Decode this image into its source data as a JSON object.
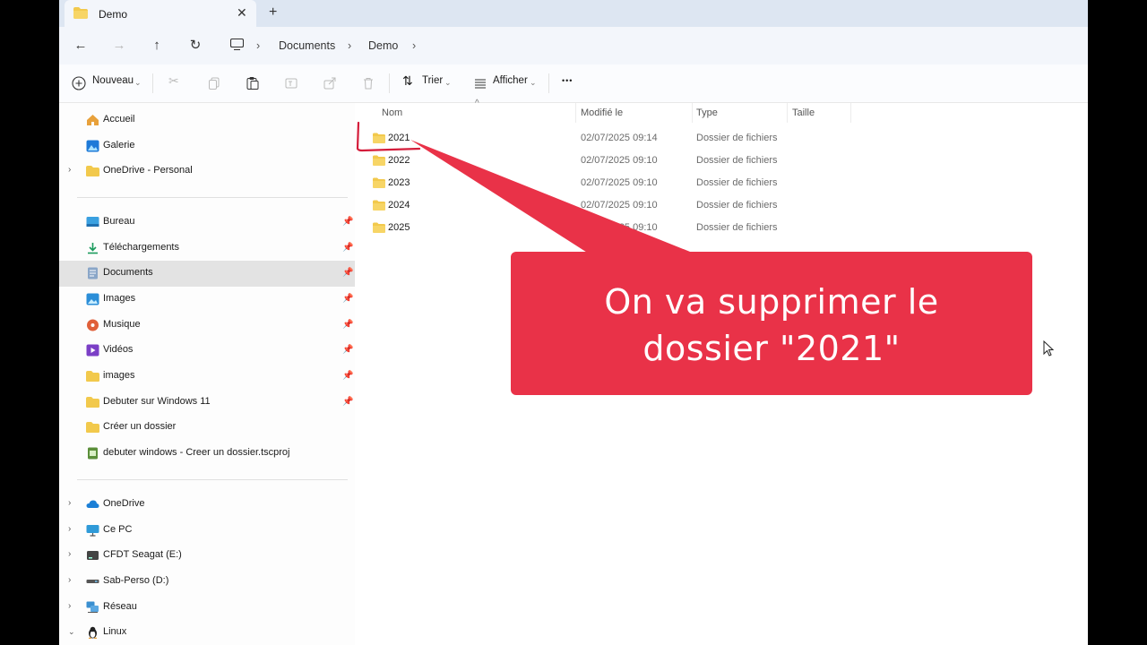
{
  "tab": {
    "title": "Demo",
    "close": "✕",
    "new": "+"
  },
  "address": {
    "crumbs": [
      "Documents",
      "Demo"
    ]
  },
  "commands": {
    "new_label": "Nouveau",
    "sort_label": "Trier",
    "view_label": "Afficher",
    "more_label": "•••"
  },
  "sidebar": {
    "quick": [
      {
        "label": "Accueil",
        "icon": "home-icon"
      },
      {
        "label": "Galerie",
        "icon": "gallery-icon"
      },
      {
        "label": "OneDrive - Personal",
        "icon": "folder-icon"
      }
    ],
    "pinned": [
      {
        "label": "Bureau",
        "icon": "desktop-icon"
      },
      {
        "label": "Téléchargements",
        "icon": "download-icon"
      },
      {
        "label": "Documents",
        "icon": "documents-icon",
        "selected": true
      },
      {
        "label": "Images",
        "icon": "images-icon"
      },
      {
        "label": "Musique",
        "icon": "music-icon"
      },
      {
        "label": "Vidéos",
        "icon": "video-icon"
      },
      {
        "label": "images",
        "icon": "folder-icon"
      },
      {
        "label": "Debuter sur Windows 11",
        "icon": "folder-icon"
      },
      {
        "label": "Créer un dossier",
        "icon": "folder-icon"
      },
      {
        "label": "debuter windows - Creer un dossier.tscproj",
        "icon": "project-file-icon"
      }
    ],
    "drives": [
      {
        "label": "OneDrive",
        "icon": "cloud-icon"
      },
      {
        "label": "Ce PC",
        "icon": "pc-icon"
      },
      {
        "label": "CFDT Seagat (E:)",
        "icon": "drive-icon"
      },
      {
        "label": "Sab-Perso (D:)",
        "icon": "drive-icon"
      },
      {
        "label": "Réseau",
        "icon": "network-icon"
      },
      {
        "label": "Linux",
        "icon": "linux-icon"
      }
    ]
  },
  "columns": {
    "name": "Nom",
    "modified": "Modifié le",
    "type": "Type",
    "size": "Taille"
  },
  "files": [
    {
      "name": "2021",
      "modified": "02/07/2025 09:14",
      "type": "Dossier de fichiers"
    },
    {
      "name": "2022",
      "modified": "02/07/2025 09:10",
      "type": "Dossier de fichiers"
    },
    {
      "name": "2023",
      "modified": "02/07/2025 09:10",
      "type": "Dossier de fichiers"
    },
    {
      "name": "2024",
      "modified": "02/07/2025 09:10",
      "type": "Dossier de fichiers"
    },
    {
      "name": "2025",
      "modified": "02/07/2025 09:10",
      "type": "Dossier de fichiers"
    }
  ],
  "annotation": {
    "line1": "On va supprimer le",
    "line2": "dossier \"2021\"",
    "color": "#e93248"
  },
  "colors": {
    "folder": "#f2c94c",
    "accent": "#0067c0"
  }
}
